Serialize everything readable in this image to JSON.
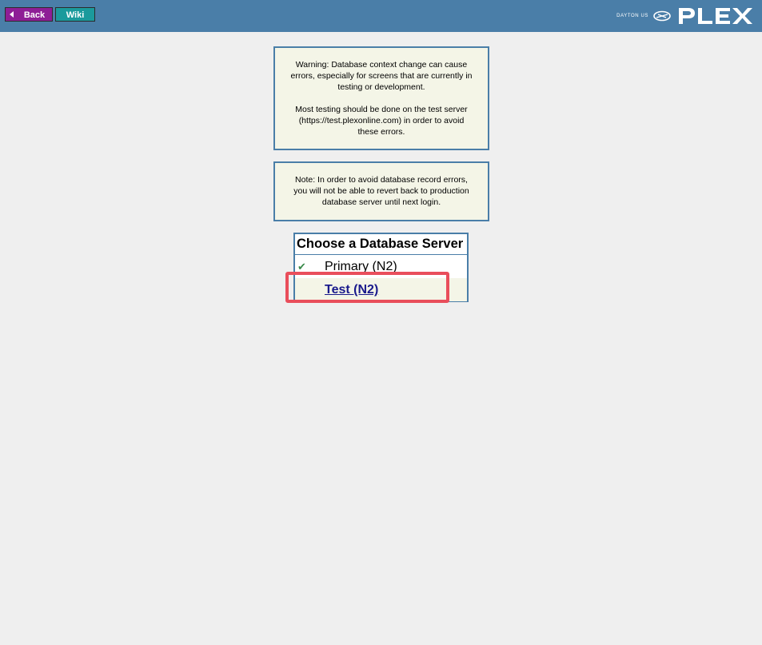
{
  "header": {
    "back_label": "Back",
    "wiki_label": "Wiki",
    "brand_tag": "DAYTON US",
    "brand_logo": "PLEX",
    "brand_color": "#4a7ea8"
  },
  "notices": {
    "warning_line1": "Warning: Database context change can cause errors, especially for screens that are currently in testing or development.",
    "warning_line2": "Most testing should be done on the test server (https://test.plexonline.com) in order to avoid these errors.",
    "note": "Note: In order to avoid database record errors, you will not be able to revert back to production database server until next login."
  },
  "server_selector": {
    "title": "Choose a Database Server",
    "options": [
      {
        "label": "Primary (N2)",
        "selected": true,
        "icon": "checkmark-icon"
      },
      {
        "label": "Test (N2)",
        "selected": false
      }
    ]
  },
  "colors": {
    "back_button": "#8e1e96",
    "wiki_button": "#1b9a9c",
    "panel_border": "#4a7ea8",
    "panel_background": "#f4f5e7",
    "highlight": "#e94e5b",
    "link": "#1a1a8c"
  }
}
